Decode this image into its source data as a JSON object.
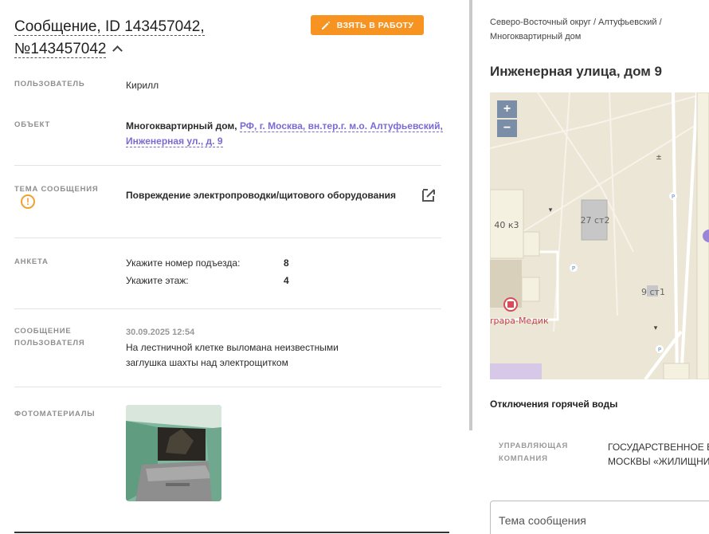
{
  "message": {
    "title": "Сообщение, ID 143457042, №143457042",
    "take_button": "ВЗЯТЬ В РАБОТУ"
  },
  "fields": {
    "user_label": "ПОЛЬЗОВАТЕЛЬ",
    "user_value": "Кирилл",
    "object_label": "ОБЪЕКТ",
    "object_type": "Многоквартирный дом,",
    "object_link": "РФ, г. Москва, вн.тер.г. м.о. Алтуфьевский, Инженерная ул., д. 9",
    "topic_label": "ТЕМА СООБЩЕНИЯ",
    "topic_value": "Повреждение электропроводки/щитового оборудования",
    "survey_label": "АНКЕТА",
    "survey": [
      {
        "q": "Укажите номер подъезда:",
        "a": "8"
      },
      {
        "q": "Укажите этаж:",
        "a": "4"
      }
    ],
    "msg_label": "СООБЩЕНИЕ ПОЛЬЗОВАТЕЛЯ",
    "msg_date": "30.09.2025 12:54",
    "msg_text": "На лестничной клетке выломана неизвестными заглушка шахты над электрощитком",
    "photos_label": "ФОТОМАТЕРИАЛЫ"
  },
  "right": {
    "breadcrumb": "Северо-Восточный округ / Алтуфьевский / Многоквартирный дом",
    "address": "Инженерная улица, дом 9",
    "map": {
      "zoom_in": "+",
      "zoom_out": "−",
      "labels": [
        "40 к3",
        "27 ст2",
        "9 ст1",
        "rpapa-Медик"
      ]
    },
    "hot_water": "Отключения горячей воды",
    "mc_label": "УПРАВЛЯЮЩАЯ КОМПАНИЯ",
    "mc_value_1": "ГОСУДАРСТВЕННОЕ Б",
    "mc_value_2": "МОСКВЫ «ЖИЛИЩНИ",
    "topic_placeholder": "Тема сообщения"
  },
  "colors": {
    "accent": "#f79320",
    "link": "#7a6ad3",
    "warning": "#f0a030",
    "map_bg": "#ece6d6"
  }
}
